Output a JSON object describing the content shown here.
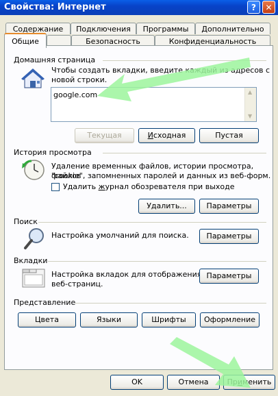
{
  "window": {
    "title": "Свойства: Интернет",
    "help_label": "?",
    "close_label": "✕"
  },
  "tabs_row1": [
    "Содержание",
    "Подключения",
    "Программы",
    "Дополнительно"
  ],
  "tabs_row2": [
    "Общие",
    "Безопасность",
    "Конфиденциальность"
  ],
  "home": {
    "title": "Домашняя страница",
    "desc_line1": "Чтобы создать вкладки, введите каждый из адресов с",
    "desc_line2": "новой строки.",
    "url": "google.com",
    "btn_current": "Текущая",
    "btn_default_prefix": "И",
    "btn_default_rest": "сходная",
    "btn_blank": "Пустая"
  },
  "history": {
    "title": "История просмотра",
    "desc_line1": "Удаление временных файлов, истории просмотра, файлов",
    "desc_line2": "\"cookie\", запомненных паролей и данных из веб-форм.",
    "checkbox_a": "Удалить ",
    "checkbox_b": "ж",
    "checkbox_c": "урнал обозревателя при выходе",
    "btn_delete": "Удалить...",
    "btn_settings": "Параметры"
  },
  "search": {
    "title": "Поиск",
    "desc": "Настройка умолчаний для поиска.",
    "btn_settings": "Параметры"
  },
  "tabs_section": {
    "title": "Вкладки",
    "desc_line1": "Настройка вкладок для отображения",
    "desc_line2": "веб-страниц.",
    "btn_settings": "Параметры"
  },
  "appearance": {
    "title": "Представление",
    "btn_colors": "Цвета",
    "btn_languages": "Языки",
    "btn_fonts": "Шрифты",
    "btn_design": "Оформление"
  },
  "footer": {
    "ok": "OK",
    "cancel": "Отмена",
    "apply_prefix": "Пр",
    "apply_u": "и",
    "apply_rest": "менить"
  },
  "colors": {
    "titlebar": "#0a4fd8",
    "annotation_arrow": "#9cf59c"
  }
}
